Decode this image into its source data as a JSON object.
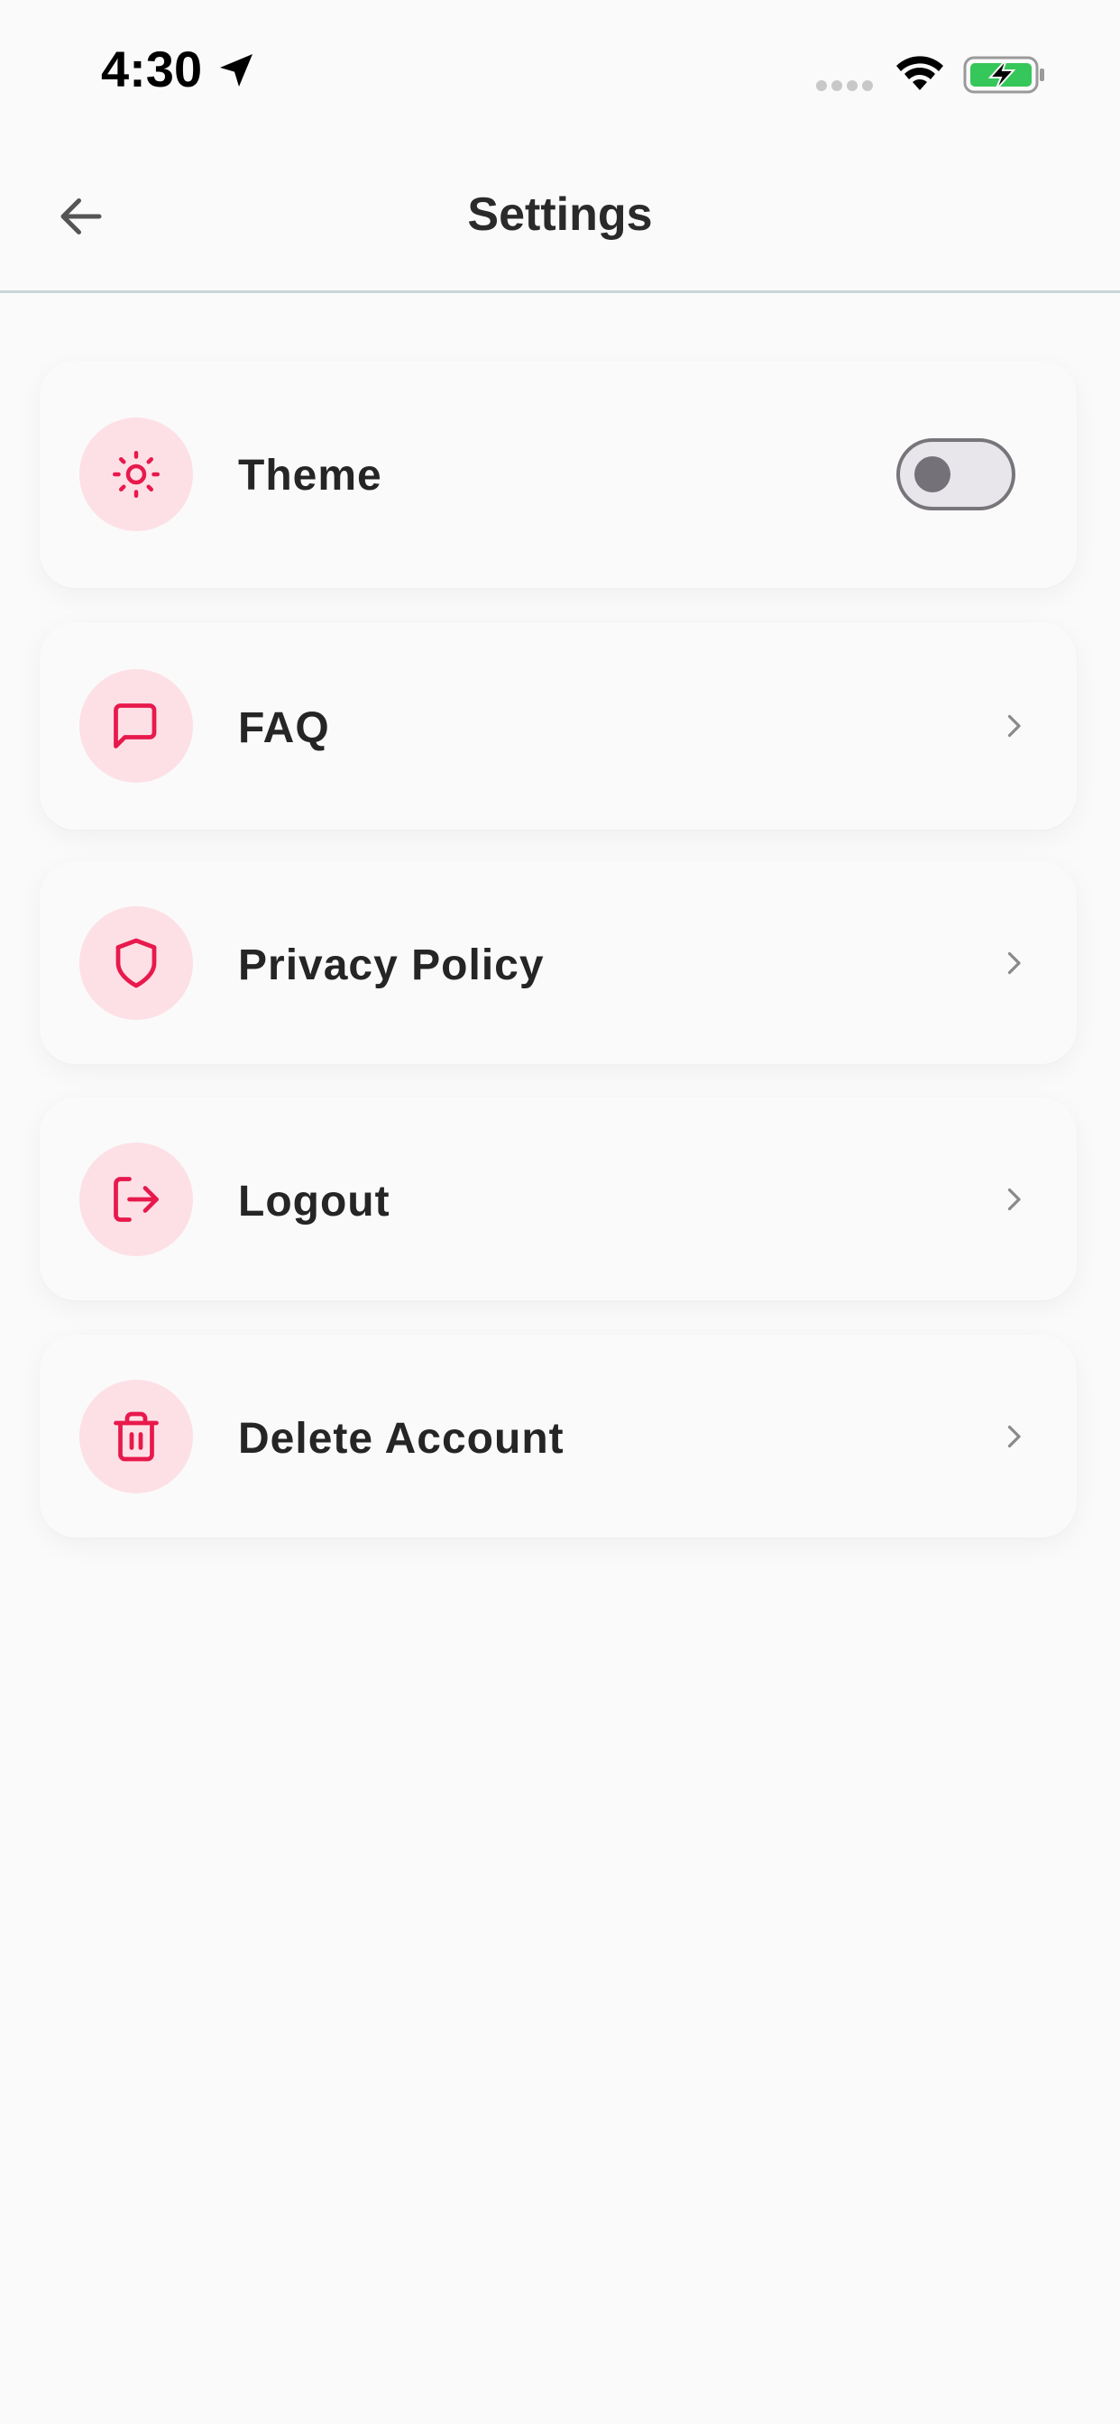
{
  "status_bar": {
    "time": "4:30",
    "icons": [
      "location-arrow-icon",
      "signal-icon",
      "wifi-icon",
      "battery-charging-icon"
    ]
  },
  "header": {
    "title": "Settings",
    "back_icon": "arrow-left-icon"
  },
  "colors": {
    "background": "#fafafa",
    "accent": "#e8194c",
    "icon_bg": "#fde0e6",
    "battery_green": "#35c759",
    "divider": "#c9d6d6"
  },
  "settings": [
    {
      "label": "Theme",
      "icon": "sun-icon",
      "control": "toggle",
      "toggle_on": false
    },
    {
      "label": "FAQ",
      "icon": "message-square-icon",
      "control": "chevron"
    },
    {
      "label": "Privacy Policy",
      "icon": "shield-icon",
      "control": "chevron"
    },
    {
      "label": "Logout",
      "icon": "logout-icon",
      "control": "chevron"
    },
    {
      "label": "Delete Account",
      "icon": "trash-icon",
      "control": "chevron"
    }
  ]
}
